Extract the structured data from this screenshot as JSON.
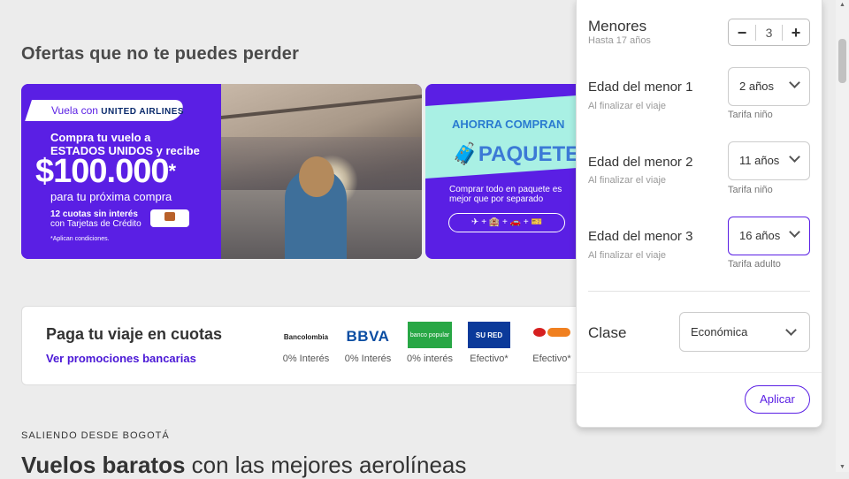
{
  "offers": {
    "heading": "Ofertas que no te puedes perder",
    "banner1": {
      "tag_prefix": "Vuela con",
      "tag_brand": "UNITED AIRLINES",
      "line1": "Compra tu vuelo a ESTADOS UNIDOS y recibe",
      "amount": "$100.000",
      "amount_mark": "*",
      "line2": "para tu próxima compra",
      "cuotas": "12 cuotas sin interés",
      "cuotas_sub": "con Tarjetas de Crédito",
      "footnote": "*Aplican condiciones."
    },
    "banner2": {
      "line1": "AHORRA COMPRAN",
      "line2": "PAQUETE",
      "line3": "Comprar todo en paquete es mejor que por separado",
      "icons": "✈ + 🏨 + 🚗 + 🎫"
    }
  },
  "cuotas_card": {
    "title": "Paga tu viaje en cuotas",
    "link": "Ver promociones bancarias",
    "banks": [
      {
        "name": "Bancolombia",
        "label": "0% Interés"
      },
      {
        "name": "BBVA",
        "label": "0% Interés"
      },
      {
        "name": "banco popular",
        "label": "0% interés"
      },
      {
        "name": "SU RED",
        "label": "Efectivo*"
      },
      {
        "name": "VIA Baloto",
        "label": "Efectivo*"
      }
    ]
  },
  "footer_section": {
    "eyebrow": "SALIENDO DESDE BOGOTÁ",
    "title_bold": "Vuelos baratos",
    "title_rest": " con las mejores aerolíneas"
  },
  "passenger_panel": {
    "menores_label": "Menores",
    "menores_sub": "Hasta 17 años",
    "menores_value": "3",
    "minus": "−",
    "plus": "+",
    "children": [
      {
        "label": "Edad del menor 1",
        "sub": "Al finalizar el viaje",
        "value": "2 años",
        "tarifa": "Tarifa niño"
      },
      {
        "label": "Edad del menor 2",
        "sub": "Al finalizar el viaje",
        "value": "11 años",
        "tarifa": "Tarifa niño"
      },
      {
        "label": "Edad del menor 3",
        "sub": "Al finalizar el viaje",
        "value": "16 años",
        "tarifa": "Tarifa adulto"
      }
    ],
    "clase_label": "Clase",
    "clase_value": "Económica",
    "apply_label": "Aplicar"
  },
  "colors": {
    "accent": "#5a1fe4",
    "link": "#4a18d6"
  }
}
